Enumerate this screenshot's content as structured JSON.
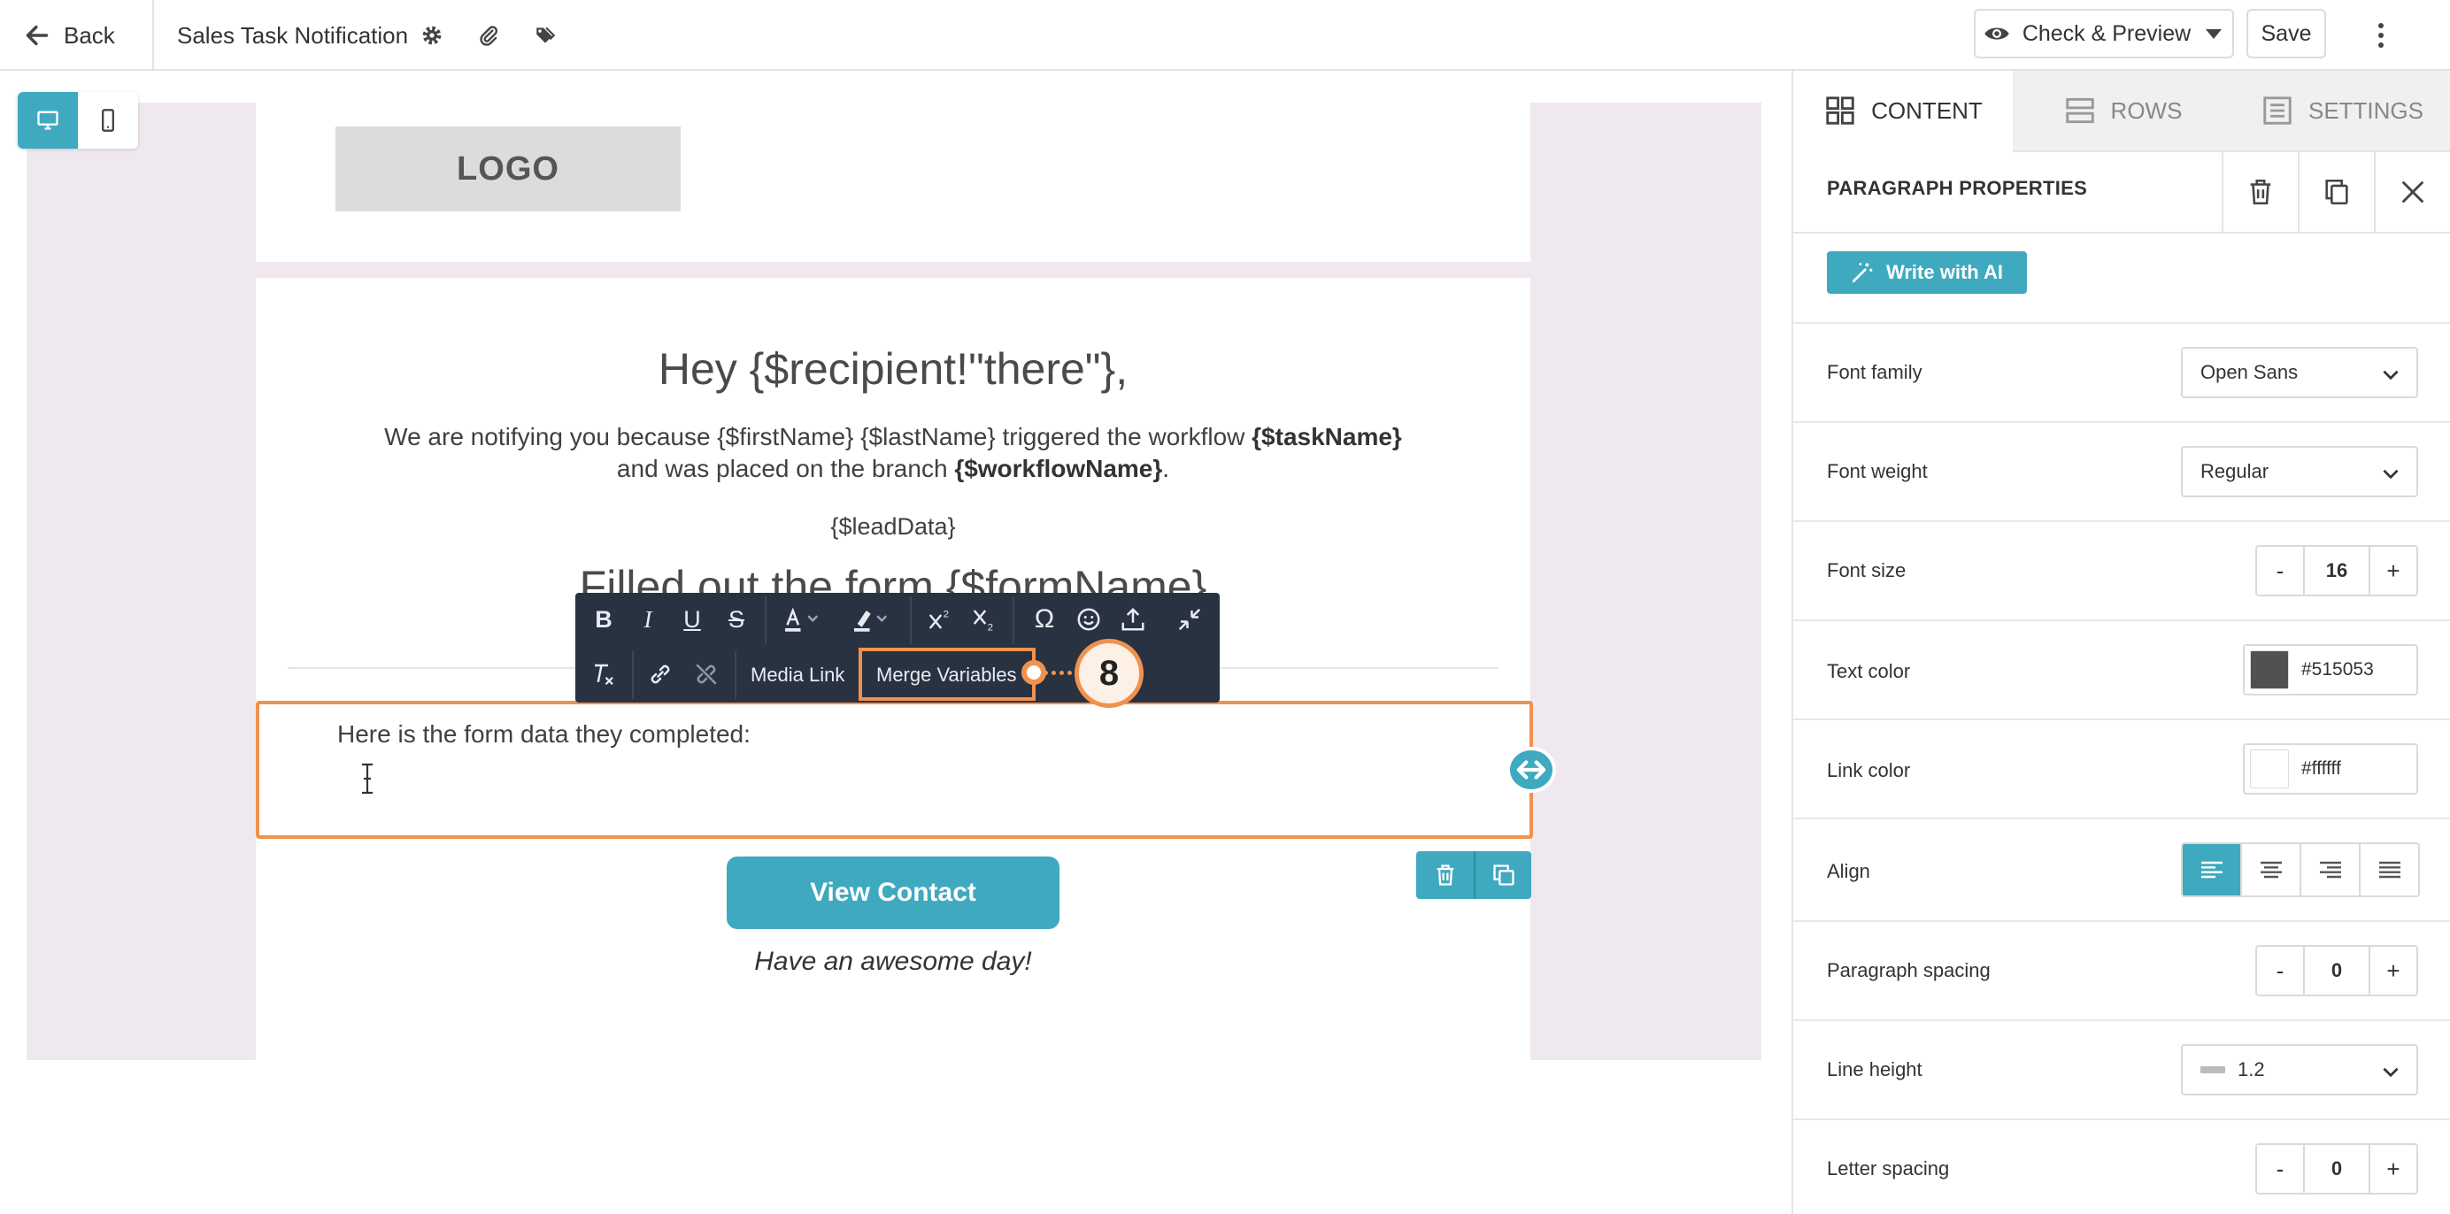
{
  "topbar": {
    "back_label": "Back",
    "title": "Sales Task Notification",
    "icons": [
      "gear-icon",
      "paperclip-icon",
      "tag-icon"
    ],
    "preview_label": "Check & Preview",
    "save_label": "Save"
  },
  "device_toggle": {
    "options": [
      "desktop-icon",
      "mobile-icon"
    ],
    "active": "desktop"
  },
  "email": {
    "logo_text": "LOGO",
    "greeting": "Hey {$recipient!\"there\"},",
    "notif_part1": "We are notifying you because {$firstName} {$lastName} triggered the workflow ",
    "notif_bold1": "{$taskName}",
    "notif_part2": "and was placed on the branch ",
    "notif_bold2": "{$workflowName}",
    "notif_end": ".",
    "lead_data": "{$leadData}",
    "form_heading": "Filled out the form {$formName}",
    "paragraph_text": "Here is the form data they completed:",
    "button_label": "View Contact",
    "signoff": "Have an awesome day!"
  },
  "text_toolbar": {
    "row1": [
      "bold",
      "italic",
      "underline",
      "strikethrough",
      "text-color",
      "highlight",
      "superscript",
      "subscript",
      "special-char",
      "emoji",
      "upload",
      "collapse"
    ],
    "media_link_label": "Media Link",
    "merge_variables_label": "Merge Variables",
    "callout_number": "8"
  },
  "panel": {
    "tabs": [
      {
        "label": "CONTENT",
        "icon": "grid-icon"
      },
      {
        "label": "ROWS",
        "icon": "rows-icon"
      },
      {
        "label": "SETTINGS",
        "icon": "settings-list-icon"
      }
    ],
    "active_tab": "CONTENT",
    "section_title": "PARAGRAPH PROPERTIES",
    "ai_button_label": "Write with AI",
    "font_family": {
      "label": "Font family",
      "value": "Open Sans"
    },
    "font_weight": {
      "label": "Font weight",
      "value": "Regular"
    },
    "font_size": {
      "label": "Font size",
      "value": "16"
    },
    "text_color": {
      "label": "Text color",
      "value": "#515053",
      "swatch": "#515053"
    },
    "link_color": {
      "label": "Link color",
      "value": "#ffffff",
      "swatch": "#ffffff"
    },
    "align": {
      "label": "Align",
      "options": [
        "left",
        "center",
        "right",
        "justify"
      ],
      "active": "left"
    },
    "paragraph_spacing": {
      "label": "Paragraph spacing",
      "value": "0"
    },
    "line_height": {
      "label": "Line height",
      "value": "1.2"
    },
    "letter_spacing": {
      "label": "Letter spacing",
      "value": "0"
    },
    "stepper_minus": "-",
    "stepper_plus": "+"
  },
  "colors": {
    "accent": "#3fa9bf",
    "highlight": "#f0924f",
    "toolbar_bg": "#283241",
    "canvas_bg": "#efe9ef"
  }
}
